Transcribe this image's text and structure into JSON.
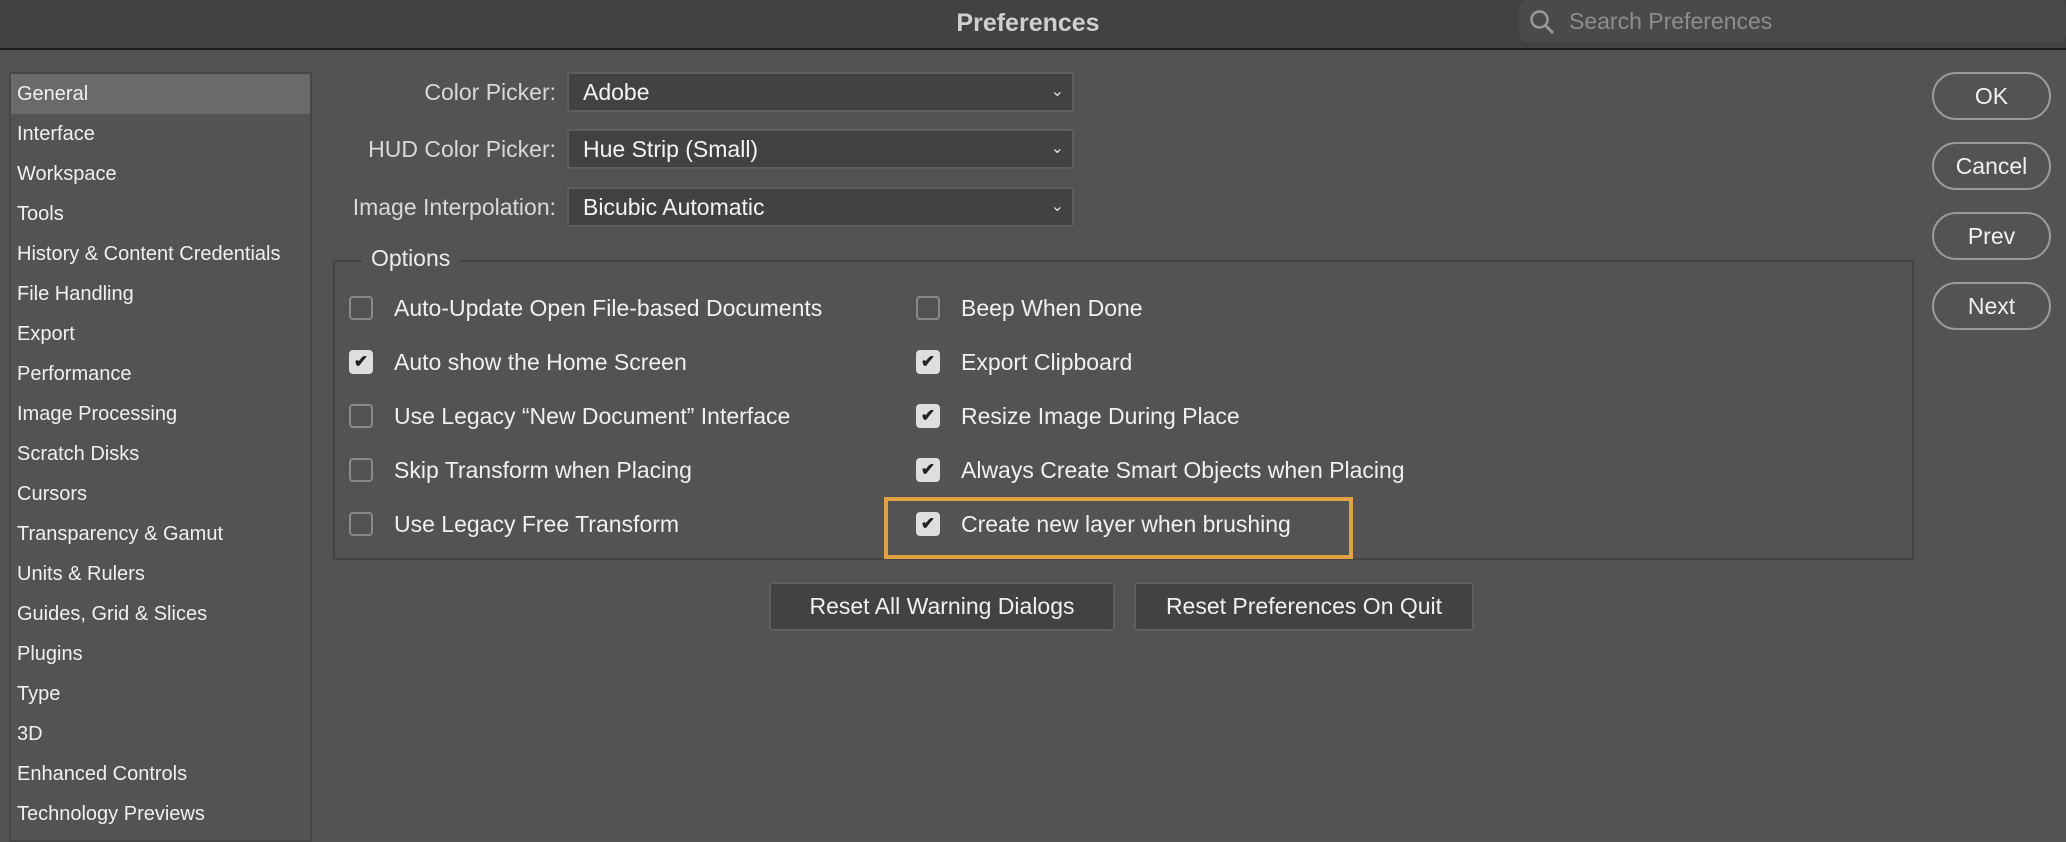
{
  "window": {
    "title": "Preferences"
  },
  "search": {
    "placeholder": "Search Preferences"
  },
  "sidebar": {
    "items": [
      {
        "label": "General",
        "selected": true
      },
      {
        "label": "Interface"
      },
      {
        "label": "Workspace"
      },
      {
        "label": "Tools"
      },
      {
        "label": "History & Content Credentials"
      },
      {
        "label": "File Handling"
      },
      {
        "label": "Export"
      },
      {
        "label": "Performance"
      },
      {
        "label": "Image Processing"
      },
      {
        "label": "Scratch Disks"
      },
      {
        "label": "Cursors"
      },
      {
        "label": "Transparency & Gamut"
      },
      {
        "label": "Units & Rulers"
      },
      {
        "label": "Guides, Grid & Slices"
      },
      {
        "label": "Plugins"
      },
      {
        "label": "Type"
      },
      {
        "label": "3D"
      },
      {
        "label": "Enhanced Controls"
      },
      {
        "label": "Technology Previews"
      }
    ]
  },
  "fields": [
    {
      "label": "Color Picker:",
      "value": "Adobe"
    },
    {
      "label": "HUD Color Picker:",
      "value": "Hue Strip (Small)"
    },
    {
      "label": "Image Interpolation:",
      "value": "Bicubic Automatic"
    }
  ],
  "options": {
    "legend": "Options",
    "left": [
      {
        "label": "Auto-Update Open File-based Documents",
        "checked": false
      },
      {
        "label": "Auto show the Home Screen",
        "checked": true
      },
      {
        "label": "Use Legacy “New Document” Interface",
        "checked": false
      },
      {
        "label": "Skip Transform when Placing",
        "checked": false
      },
      {
        "label": "Use Legacy Free Transform",
        "checked": false
      }
    ],
    "right": [
      {
        "label": "Beep When Done",
        "checked": false
      },
      {
        "label": "Export Clipboard",
        "checked": true
      },
      {
        "label": "Resize Image During Place",
        "checked": true
      },
      {
        "label": "Always Create Smart Objects when Placing",
        "checked": true
      },
      {
        "label": "Create new layer when brushing",
        "checked": true,
        "highlighted": true
      }
    ]
  },
  "buttons": {
    "reset_warnings": "Reset All Warning Dialogs",
    "reset_prefs": "Reset Preferences On Quit",
    "ok": "OK",
    "cancel": "Cancel",
    "prev": "Prev",
    "next": "Next"
  },
  "colors": {
    "highlight": "#e0a244"
  }
}
